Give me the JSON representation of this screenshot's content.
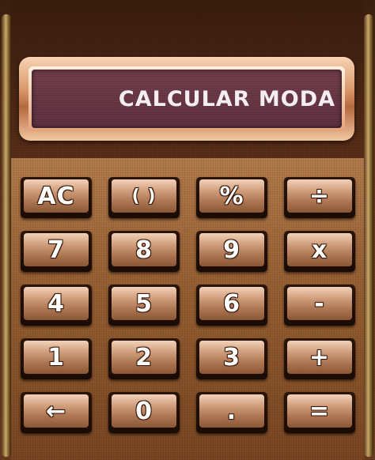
{
  "display": {
    "text": "CALCULAR MODA"
  },
  "keys": [
    [
      "AC",
      "( )",
      "%",
      "÷"
    ],
    [
      "7",
      "8",
      "9",
      "x"
    ],
    [
      "4",
      "5",
      "6",
      "-"
    ],
    [
      "1",
      "2",
      "3",
      "+"
    ],
    [
      "←",
      "0",
      ".",
      "="
    ]
  ],
  "colors": {
    "display_bg": "#5a2d3c",
    "key_face": "#cf9d7c",
    "frame": "#5a3219",
    "keypad_bg": "#9a6234"
  }
}
